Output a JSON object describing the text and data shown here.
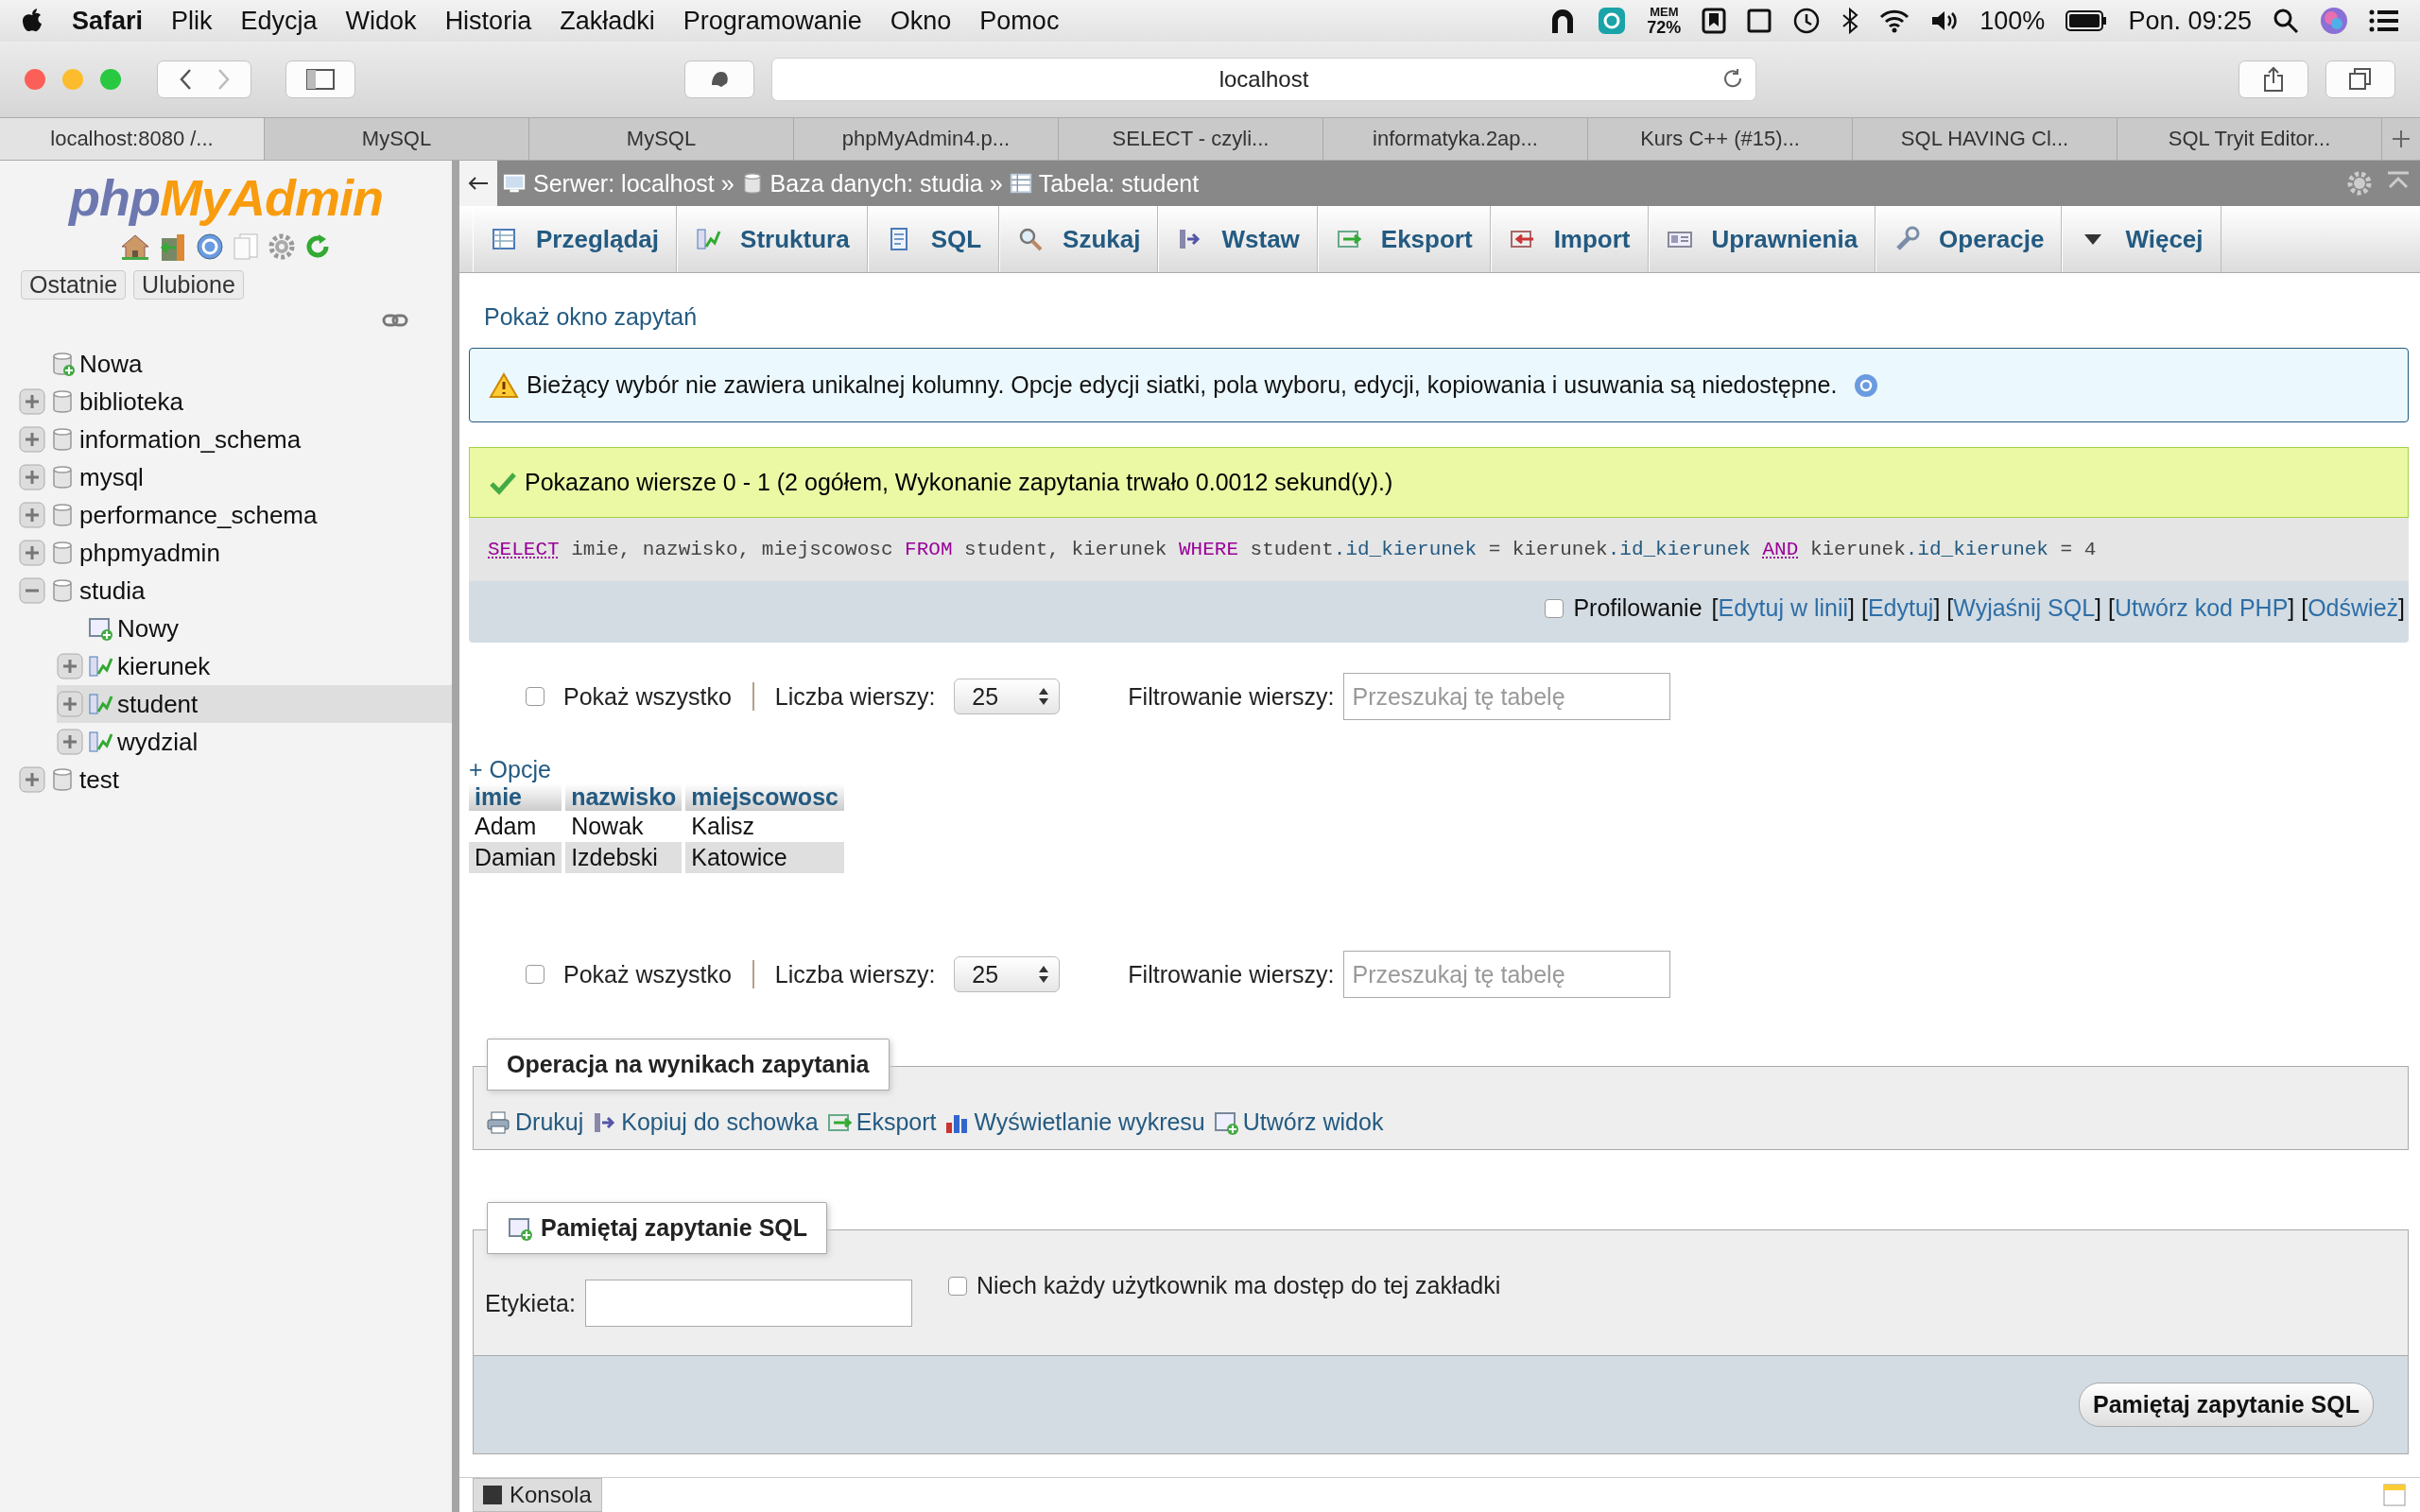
{
  "menu_bar": {
    "app": "Safari",
    "items": [
      "Plik",
      "Edycja",
      "Widok",
      "Historia",
      "Zakładki",
      "Programowanie",
      "Okno",
      "Pomoc"
    ],
    "mem_label": "MEM",
    "mem_value": "72%",
    "battery": "100%",
    "clock": "Pon. 09:25"
  },
  "browser": {
    "address": "localhost",
    "tabs": [
      {
        "label": "localhost:8080 /...",
        "selected": true
      },
      {
        "label": "MySQL",
        "selected": false
      },
      {
        "label": "MySQL",
        "selected": false
      },
      {
        "label": "phpMyAdmin4.p...",
        "selected": false
      },
      {
        "label": "SELECT - czyli...",
        "selected": false
      },
      {
        "label": "informatyka.2ap...",
        "selected": false
      },
      {
        "label": "Kurs C++ (#15)...",
        "selected": false
      },
      {
        "label": "SQL HAVING Cl...",
        "selected": false
      },
      {
        "label": "SQL Tryit Editor...",
        "selected": false
      }
    ]
  },
  "sidebar": {
    "logo": [
      "php",
      "MyAdmin"
    ],
    "buttons": [
      "Ostatnie",
      "Ulubione"
    ],
    "tree": [
      {
        "kind": "new",
        "label": "Nowa",
        "selected": false
      },
      {
        "kind": "db",
        "label": "biblioteka",
        "expanded": false,
        "selected": false
      },
      {
        "kind": "db",
        "label": "information_schema",
        "expanded": false,
        "selected": false
      },
      {
        "kind": "db",
        "label": "mysql",
        "expanded": false,
        "selected": false
      },
      {
        "kind": "db",
        "label": "performance_schema",
        "expanded": false,
        "selected": false
      },
      {
        "kind": "db",
        "label": "phpmyadmin",
        "expanded": false,
        "selected": false
      },
      {
        "kind": "db",
        "label": "studia",
        "expanded": true,
        "selected": false,
        "children": [
          {
            "kind": "new-table",
            "label": "Nowy",
            "selected": false
          },
          {
            "kind": "table",
            "label": "kierunek",
            "expanded": false,
            "selected": false
          },
          {
            "kind": "table",
            "label": "student",
            "expanded": false,
            "selected": true
          },
          {
            "kind": "table",
            "label": "wydzial",
            "expanded": false,
            "selected": false
          }
        ]
      },
      {
        "kind": "db",
        "label": "test",
        "expanded": false,
        "selected": false
      }
    ]
  },
  "breadcrumb": [
    {
      "kind": "server",
      "label": "Serwer: localhost",
      "separator": "»"
    },
    {
      "kind": "db",
      "label": "Baza danych: studia",
      "separator": "»"
    },
    {
      "kind": "table",
      "label": "Tabela: student"
    }
  ],
  "tabs": [
    {
      "kind": "browse",
      "label": "Przeglądaj"
    },
    {
      "kind": "structure",
      "label": "Struktura"
    },
    {
      "kind": "sql",
      "label": "SQL"
    },
    {
      "kind": "search",
      "label": "Szukaj"
    },
    {
      "kind": "insert",
      "label": "Wstaw"
    },
    {
      "kind": "export",
      "label": "Eksport"
    },
    {
      "kind": "import",
      "label": "Import"
    },
    {
      "kind": "privileges",
      "label": "Uprawnienia"
    },
    {
      "kind": "operations",
      "label": "Operacje"
    },
    {
      "kind": "more",
      "label": "Więcej"
    }
  ],
  "query_window_link": "Pokaż okno zapytań",
  "notice": "Bieżący wybór nie zawiera unikalnej kolumny. Opcje edycji siatki, pola wyboru, edycji, kopiowania i usuwania są niedostępne.",
  "success": "Pokazano wiersze 0 - 1 (2 ogółem, Wykonanie zapytania trwało 0.0012 sekund(y).)",
  "sql": [
    {
      "kind": "keyword-link",
      "text": "SELECT"
    },
    {
      "kind": "plain",
      "text": " imie, nazwisko, miejscowosc "
    },
    {
      "kind": "keyword",
      "text": "FROM"
    },
    {
      "kind": "plain",
      "text": " student, kierunek "
    },
    {
      "kind": "keyword",
      "text": "WHERE"
    },
    {
      "kind": "plain",
      "text": " student"
    },
    {
      "kind": "column",
      "text": ".id_kierunek"
    },
    {
      "kind": "plain",
      "text": " = kierunek"
    },
    {
      "kind": "column",
      "text": ".id_kierunek "
    },
    {
      "kind": "keyword-link",
      "text": "AND"
    },
    {
      "kind": "plain",
      "text": " kierunek"
    },
    {
      "kind": "column",
      "text": ".id_kierunek"
    },
    {
      "kind": "plain",
      "text": " = 4"
    }
  ],
  "profiling": {
    "label": "Profilowanie",
    "checked": false,
    "parts": [
      {
        "kind": "text",
        "text": "["
      },
      {
        "kind": "link",
        "text": "Edytuj w linii"
      },
      {
        "kind": "text",
        "text": "] ["
      },
      {
        "kind": "link",
        "text": "Edytuj"
      },
      {
        "kind": "text",
        "text": "] ["
      },
      {
        "kind": "link",
        "text": "Wyjaśnij SQL"
      },
      {
        "kind": "text",
        "text": "] ["
      },
      {
        "kind": "link",
        "text": "Utwórz kod PHP"
      },
      {
        "kind": "text",
        "text": "] ["
      },
      {
        "kind": "link",
        "text": "Odśwież"
      },
      {
        "kind": "text",
        "text": "]"
      }
    ]
  },
  "nav_rows": [
    {
      "show_all": "Pokaż wszystko",
      "show_all_checked": false,
      "rows_label": "Liczba wierszy:",
      "rows_value": "25",
      "filter_label": "Filtrowanie wierszy:",
      "filter_placeholder": "Przeszukaj tę tabelę"
    },
    {
      "show_all": "Pokaż wszystko",
      "show_all_checked": false,
      "rows_label": "Liczba wierszy:",
      "rows_value": "25",
      "filter_label": "Filtrowanie wierszy:",
      "filter_placeholder": "Przeszukaj tę tabelę"
    }
  ],
  "options_link": "+ Opcje",
  "table": {
    "columns": [
      "imie",
      "nazwisko",
      "miejscowosc"
    ],
    "rows": [
      [
        "Adam",
        "Nowak",
        "Kalisz"
      ],
      [
        "Damian",
        "Izdebski",
        "Katowice"
      ]
    ]
  },
  "operations": {
    "legend": "Operacja na wynikach zapytania",
    "links": [
      {
        "kind": "print",
        "label": "Drukuj"
      },
      {
        "kind": "copy",
        "label": "Kopiuj do schowka"
      },
      {
        "kind": "export",
        "label": "Eksport"
      },
      {
        "kind": "chart",
        "label": "Wyświetlanie wykresu"
      },
      {
        "kind": "view",
        "label": "Utwórz widok"
      }
    ]
  },
  "bookmark": {
    "legend": "Pamiętaj zapytanie SQL",
    "label_field": "Etykieta:",
    "share_label": "Niech każdy użytkownik ma dostęp do tej zakładki",
    "share_checked": false,
    "button": "Pamiętaj zapytanie SQL"
  },
  "console": "Konsola"
}
